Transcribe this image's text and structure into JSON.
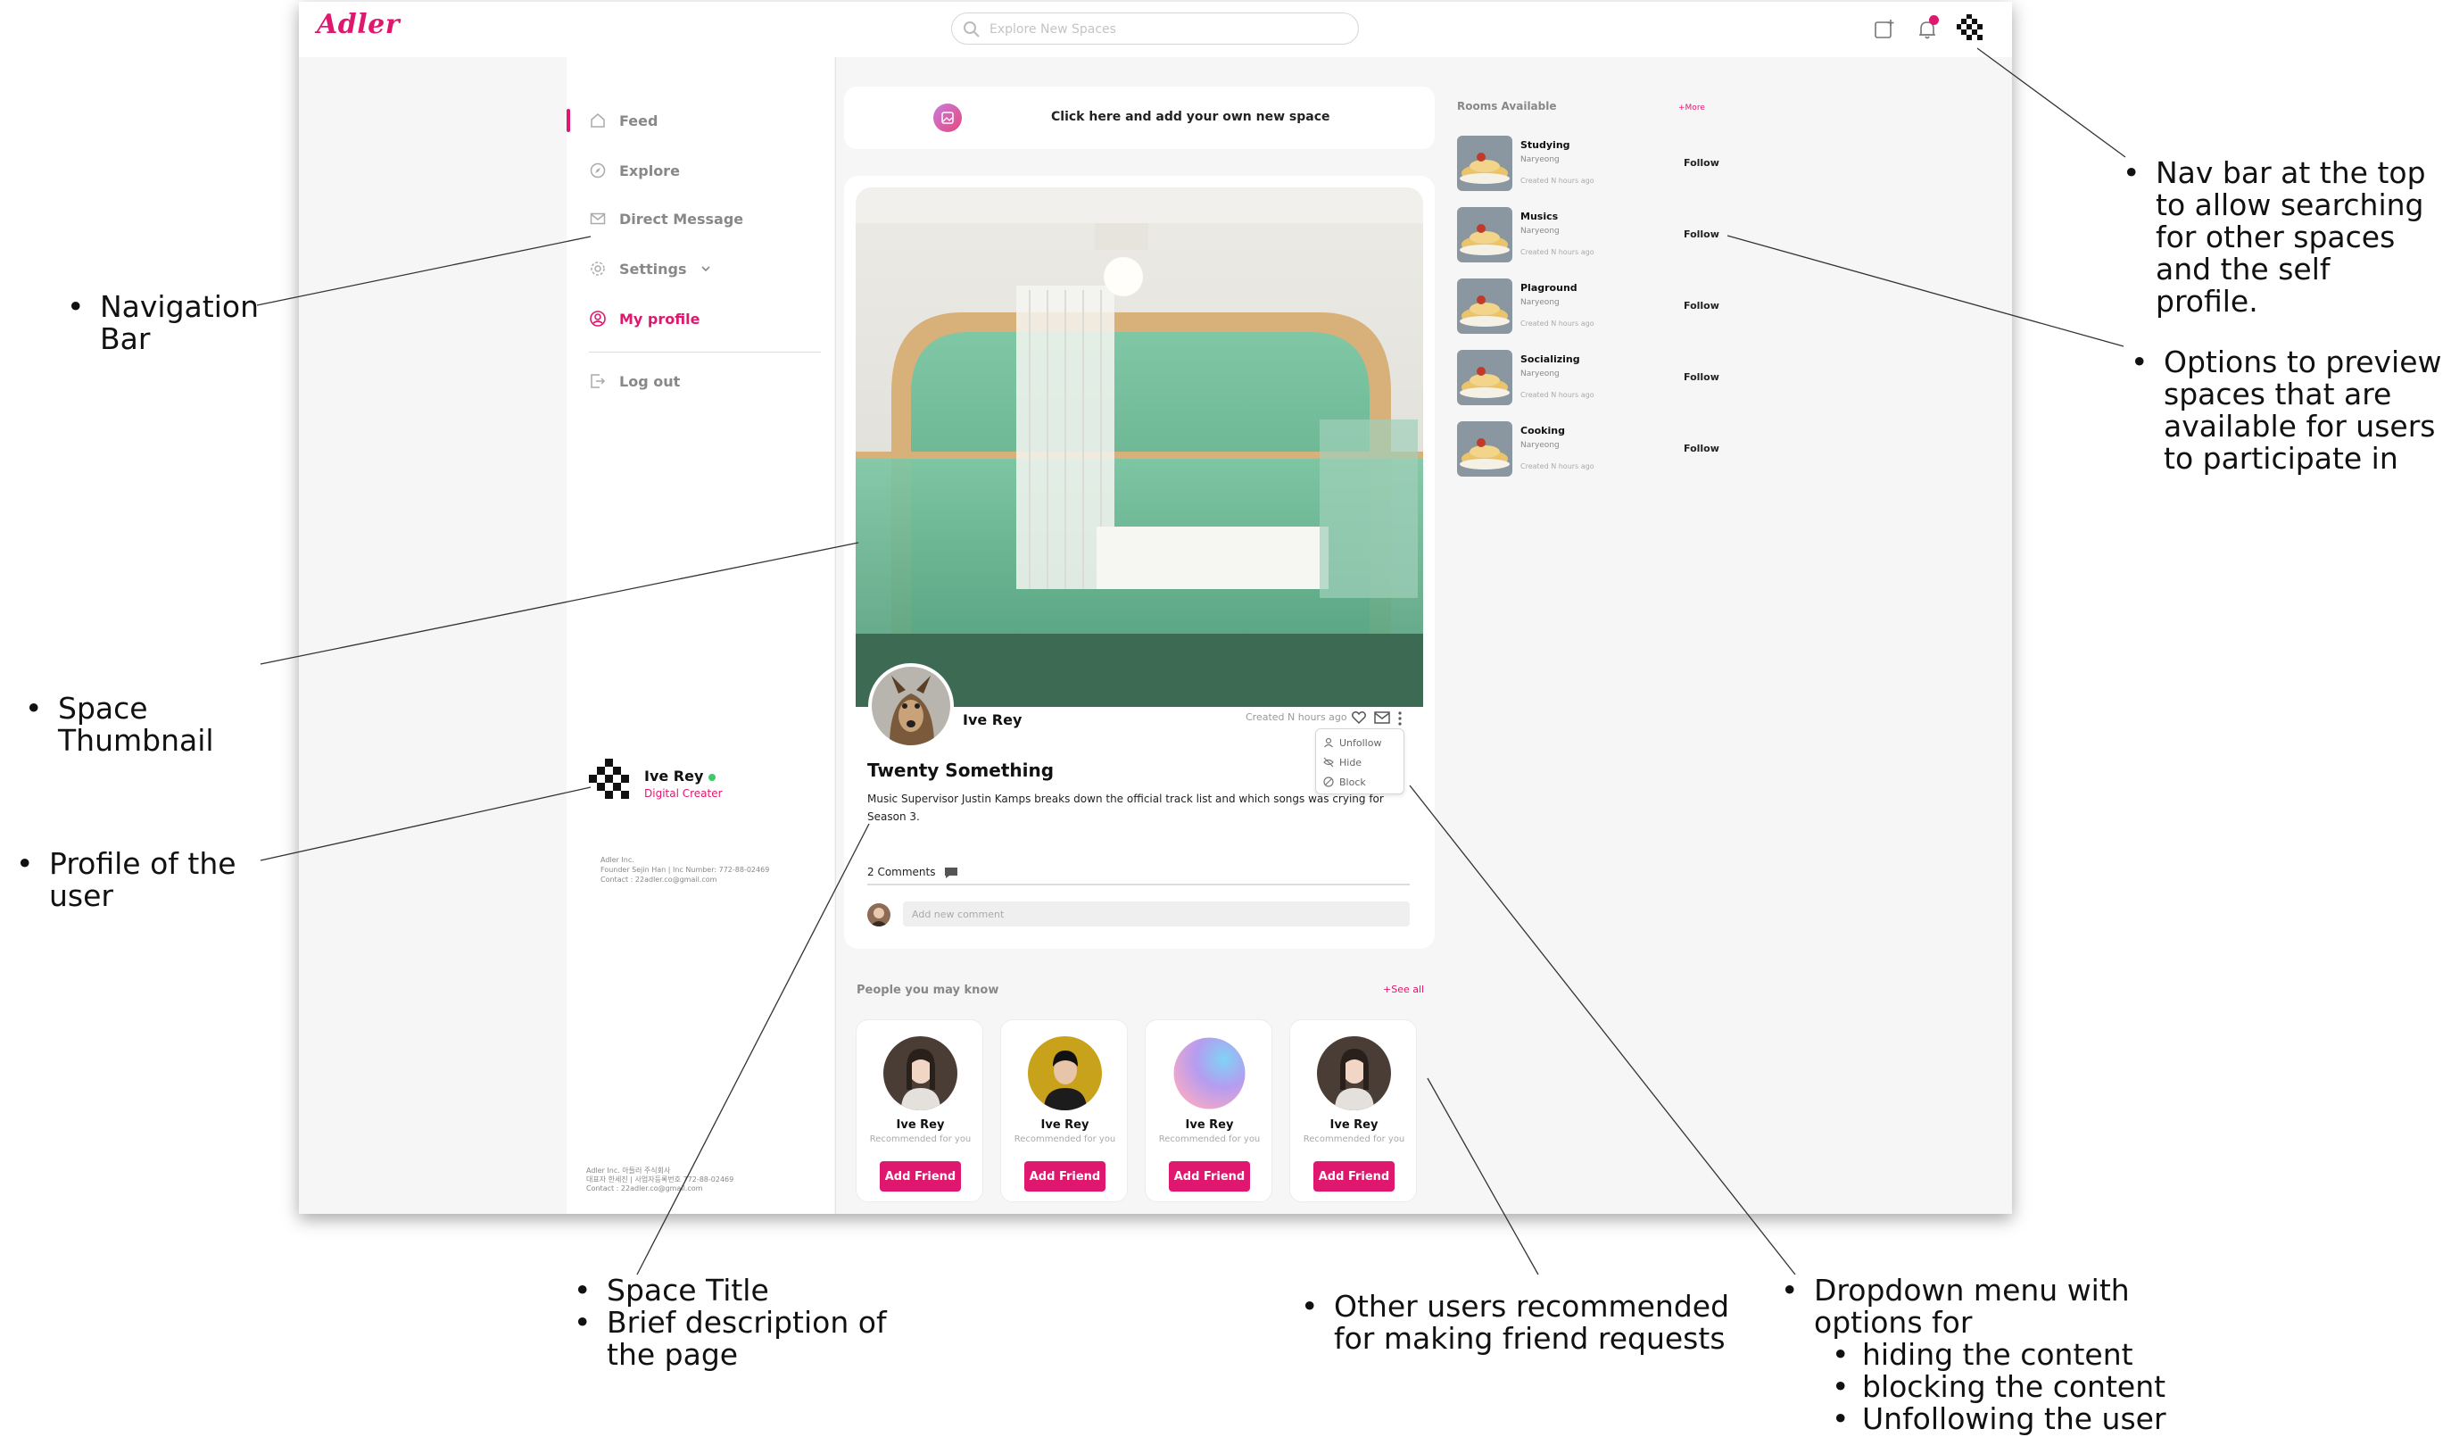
{
  "app": {
    "logo": "Adler",
    "search_placeholder": "Explore New Spaces",
    "brand_color": "#e0176e"
  },
  "sidebar": {
    "items": [
      {
        "label": "Feed",
        "icon": "home-icon"
      },
      {
        "label": "Explore",
        "icon": "compass-icon"
      },
      {
        "label": "Direct Message",
        "icon": "mail-icon"
      },
      {
        "label": "Settings",
        "icon": "gear-icon"
      },
      {
        "label": "My profile",
        "icon": "user-circle-icon"
      },
      {
        "label": "Log out",
        "icon": "logout-icon"
      }
    ],
    "profile": {
      "name": "Ive Rey",
      "role": "Digital Creater"
    },
    "company_info": [
      "Adler Inc.",
      "Founder Sejin Han | Inc Number: 772-88-02469",
      "Contact : 22adler.co@gmail.com"
    ],
    "company_footer": [
      "Adler Inc. 아들러 주식회사",
      "대표자 한세진 | 사업자등록번호 772-88-02469",
      "Contact : 22adler.co@gmail.com"
    ]
  },
  "add_space": {
    "label": "Click here and add your own new space"
  },
  "post": {
    "author": "Ive Rey",
    "created": "Created N hours ago",
    "title": "Twenty Something",
    "description": "Music Supervisor Justin Kamps breaks down the official track list and which songs was crying for Season 3.",
    "comments": "2 Comments",
    "comment_placeholder": "Add new comment",
    "menu": [
      "Unfollow",
      "Hide",
      "Block"
    ]
  },
  "people": {
    "title": "People you may know",
    "more": "+See all",
    "cards": [
      {
        "name": "Ive Rey",
        "sub": "Recommended for you",
        "button": "Add Friend"
      },
      {
        "name": "Ive Rey",
        "sub": "Recommended for you",
        "button": "Add Friend"
      },
      {
        "name": "Ive Rey",
        "sub": "Recommended for you",
        "button": "Add Friend"
      },
      {
        "name": "Ive Rey",
        "sub": "Recommended for you",
        "button": "Add Friend"
      }
    ]
  },
  "rooms": {
    "title": "Rooms Available",
    "more": "+More",
    "items": [
      {
        "name": "Studying",
        "owner": "Naryeong",
        "created": "Created N hours ago",
        "follow": "Follow"
      },
      {
        "name": "Musics",
        "owner": "Naryeong",
        "created": "Created N hours ago",
        "follow": "Follow"
      },
      {
        "name": "Plaground",
        "owner": "Naryeong",
        "created": "Created N hours ago",
        "follow": "Follow"
      },
      {
        "name": "Socializing",
        "owner": "Naryeong",
        "created": "Created N hours ago",
        "follow": "Follow"
      },
      {
        "name": "Cooking",
        "owner": "Naryeong",
        "created": "Created N hours ago",
        "follow": "Follow"
      }
    ]
  },
  "annotations": {
    "navigation_bar": [
      "Navigation",
      "Bar"
    ],
    "space_thumbnail": [
      "Space",
      "Thumbnail"
    ],
    "profile_user": [
      "Profile of the",
      "user"
    ],
    "nav_top": [
      "Nav bar at the top",
      "to allow searching",
      "for other spaces",
      "and the self",
      "profile."
    ],
    "preview_spaces": [
      "Options to preview",
      "spaces that are",
      "available for users",
      "to participate in"
    ],
    "space_title": [
      "Space Title",
      "Brief description of",
      "the page"
    ],
    "recommended": [
      "Other users recommended",
      "for making friend requests"
    ],
    "dropdown": [
      "Dropdown menu with",
      "options for",
      "hiding the content",
      "blocking the content",
      "Unfollowing the user"
    ]
  }
}
